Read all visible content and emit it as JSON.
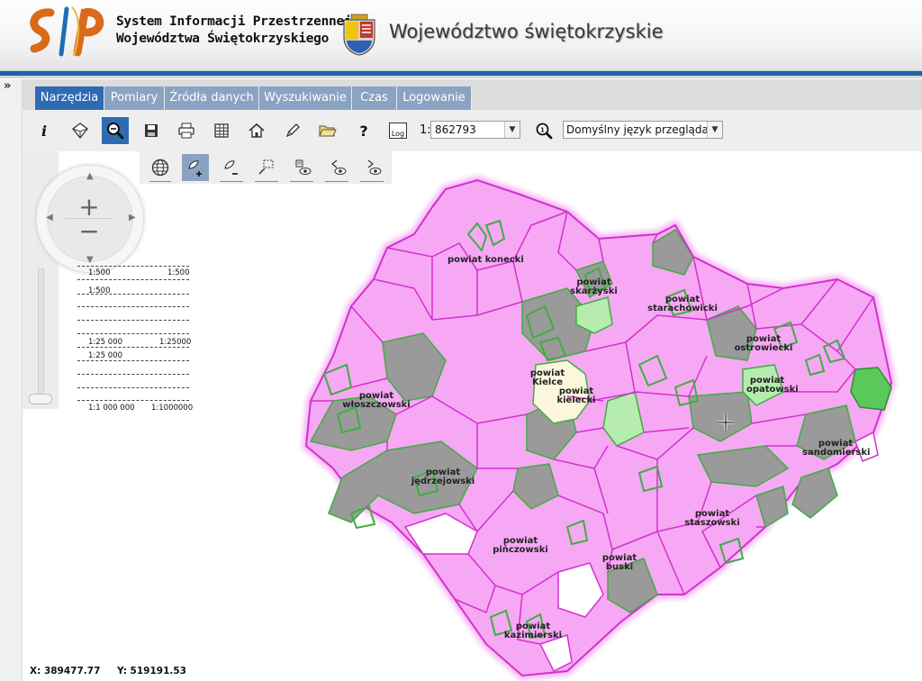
{
  "header": {
    "logo_text": "SIP",
    "system_line1": "System Informacji Przestrzennej",
    "system_line2": "Województwa Świętokrzyskiego",
    "region_title": "Województwo świętokrzyskie"
  },
  "tabs": [
    {
      "label": "Narzędzia",
      "active": true
    },
    {
      "label": "Pomiary",
      "active": false
    },
    {
      "label": "Źródła danych",
      "active": false
    },
    {
      "label": "Wyszukiwanie",
      "active": false
    },
    {
      "label": "Czas",
      "active": false
    },
    {
      "label": "Logowanie",
      "active": false
    }
  ],
  "toolbar": {
    "icons": [
      "info-icon",
      "layers-icon",
      "zoom-icon",
      "save-icon",
      "print-icon",
      "table-icon",
      "home-icon",
      "draw-icon",
      "folder-icon",
      "help-icon",
      "log-icon"
    ],
    "help_label": "?",
    "info_label": "i",
    "log_label": "Log",
    "scale_prefix": "1:",
    "scale_value": "862793",
    "language_value": "Domyślny język przeglądarki"
  },
  "subtoolbar": {
    "icons": [
      "globe-icon",
      "select-add-icon",
      "select-remove-icon",
      "select-rect-icon",
      "select-visible-icon",
      "undo-visible-icon",
      "redo-visible-icon"
    ]
  },
  "navigation": {
    "zoom_in": "+",
    "zoom_out": "−",
    "scales": [
      {
        "left": "1:500",
        "right": "1:500"
      },
      {
        "left": "1:500",
        "right": ""
      },
      {
        "left": "1:25 000",
        "right": "1:25000"
      },
      {
        "left": "1:25 000",
        "right": ""
      },
      {
        "left": "1:1 000 000",
        "right": "1:1000000"
      }
    ]
  },
  "coordinates": {
    "x": "X: 389477.77",
    "y": "Y: 519191.53"
  },
  "map": {
    "colors": {
      "pink": "#f6a8f4",
      "pink_border": "#d430d0",
      "gray": "#9a9a9a",
      "green": "#3fae3f",
      "light_green": "#b6ecb0",
      "cream": "#fbf6dc"
    },
    "labels": [
      {
        "text": "powiat konecki"
      },
      {
        "text": "powiat skarżyski"
      },
      {
        "text": "powiat starachowicki"
      },
      {
        "text": "powiat ostrowiecki"
      },
      {
        "text": "powiat opatowski"
      },
      {
        "text": "powiat Kielce"
      },
      {
        "text": "powiat kielecki"
      },
      {
        "text": "powiat włoszczowski"
      },
      {
        "text": "powiat jędrzejowski"
      },
      {
        "text": "powiat sandomierski"
      },
      {
        "text": "powiat staszowski"
      },
      {
        "text": "powiat pińczowski"
      },
      {
        "text": "powiat buski"
      },
      {
        "text": "powiat kazimierski"
      }
    ]
  }
}
